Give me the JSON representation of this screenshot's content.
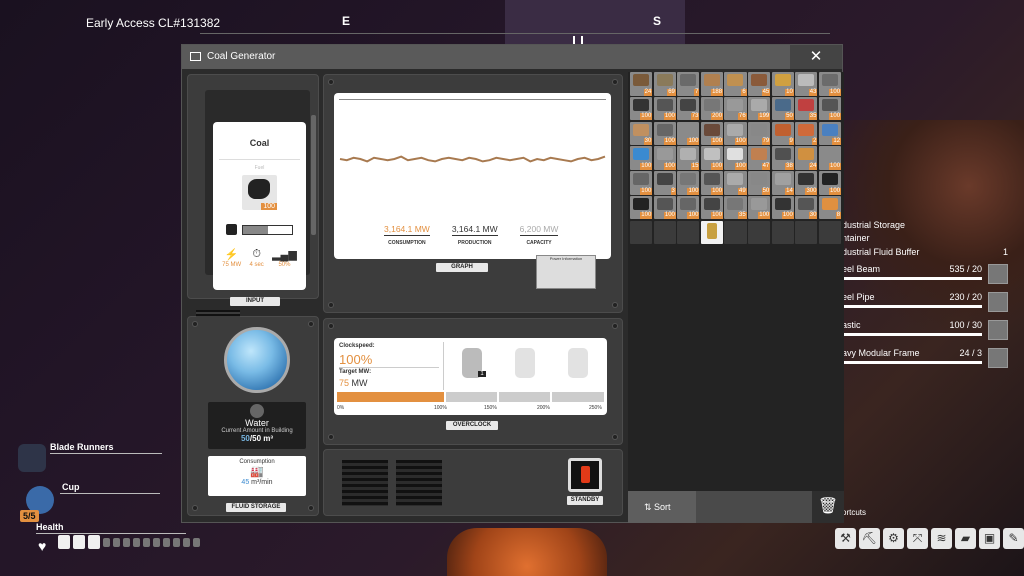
{
  "version": "Early Access CL#131382",
  "compass": {
    "e": "E",
    "s": "S"
  },
  "left_hud": {
    "item1": "Blade Runners",
    "item2": "Cup",
    "badge": "5/5",
    "health": "Health"
  },
  "window": {
    "title": "Coal Generator",
    "close": "✕",
    "input": {
      "tag": "INPUT",
      "name": "Coal",
      "fuel_label": "Fuel",
      "count": "100",
      "power": "75 MW",
      "time": "4 sec",
      "percent": "50%"
    },
    "graph": {
      "tag": "GRAPH",
      "consumption_value": "3,164.1 MW",
      "consumption_label": "CONSUMPTION",
      "production_value": "3,164.1 MW",
      "production_label": "PRODUCTION",
      "capacity_value": "6,200 MW",
      "capacity_label": "CAPACITY",
      "plate_title": "Power Information"
    },
    "fluid": {
      "name": "Water",
      "subtitle": "Current Amount in Building",
      "current": "50",
      "max": "/50 m³",
      "consumption_label": "Consumption",
      "rate_value": "45",
      "rate_unit": "m³/min",
      "tag": "FLUID STORAGE"
    },
    "overclock": {
      "clock_label": "Clockspeed:",
      "clock_value": "100%",
      "target_label": "Target MW:",
      "target_value": "75",
      "target_unit": " MW",
      "shard_count": "1",
      "scale": [
        "0%",
        "100%",
        "150%",
        "200%",
        "250%"
      ],
      "tag": "OVERCLOCK"
    },
    "standby_tag": "STANDBY",
    "sort_label": "Sort",
    "inventory": [
      [
        "24",
        "69",
        "7",
        "188",
        "6",
        "45",
        "10",
        "43",
        "100"
      ],
      [
        "100",
        "100",
        "73",
        "200",
        "76",
        "199",
        "50",
        "35",
        "100"
      ],
      [
        "30",
        "100",
        "100",
        "100",
        "100",
        "79",
        "9",
        "2",
        "12"
      ],
      [
        "100",
        "100",
        "15",
        "100",
        "100",
        "47",
        "38",
        "24",
        "100"
      ],
      [
        "100",
        "3",
        "100",
        "100",
        "49",
        "50",
        "14",
        "300",
        "100"
      ],
      [
        "100",
        "100",
        "100",
        "100",
        "35",
        "100",
        "100",
        "30",
        "8"
      ]
    ],
    "inventory_colors": [
      [
        "#7a5a3a",
        "#8a7a5a",
        "#6a6a6a",
        "#b08050",
        "#c09050",
        "#8a5a3a",
        "#d0a040",
        "#bbb",
        "#6b6b6b"
      ],
      [
        "#333",
        "#555",
        "#444",
        "#777",
        "#999",
        "#aaa",
        "#4a6a8a",
        "#c04040",
        "#555"
      ],
      [
        "#c09060",
        "#666",
        "#8a8a8a",
        "#6a4a3a",
        "#aaa",
        "#888",
        "#c06030",
        "#d06a3a",
        "#4a80c0"
      ],
      [
        "#3a8ad0",
        "#999",
        "#b0b0b0",
        "#c0c0c0",
        "#e0e0e0",
        "#c08050",
        "#505050",
        "#d09040",
        "#8a8a8a"
      ],
      [
        "#666",
        "#444",
        "#777",
        "#555",
        "#aaa",
        "#888",
        "#a0a0a0",
        "#333",
        "#222"
      ],
      [
        "#222",
        "#555",
        "#666",
        "#444",
        "#777",
        "#999",
        "#333",
        "#555",
        "#e09040"
      ]
    ]
  },
  "right_hud": {
    "storage1": "dustrial Storage",
    "storage2": "ntainer",
    "storage3": "dustrial Fluid Buffer",
    "storage3_count": "1",
    "rows": [
      {
        "name": "eel Beam",
        "value": "535 / 20"
      },
      {
        "name": "eel Pipe",
        "value": "230 / 20"
      },
      {
        "name": "astic",
        "value": "100 / 30"
      },
      {
        "name": "avy Modular Frame",
        "value": "24 / 3"
      }
    ],
    "shortcuts_label": "ortcuts"
  }
}
